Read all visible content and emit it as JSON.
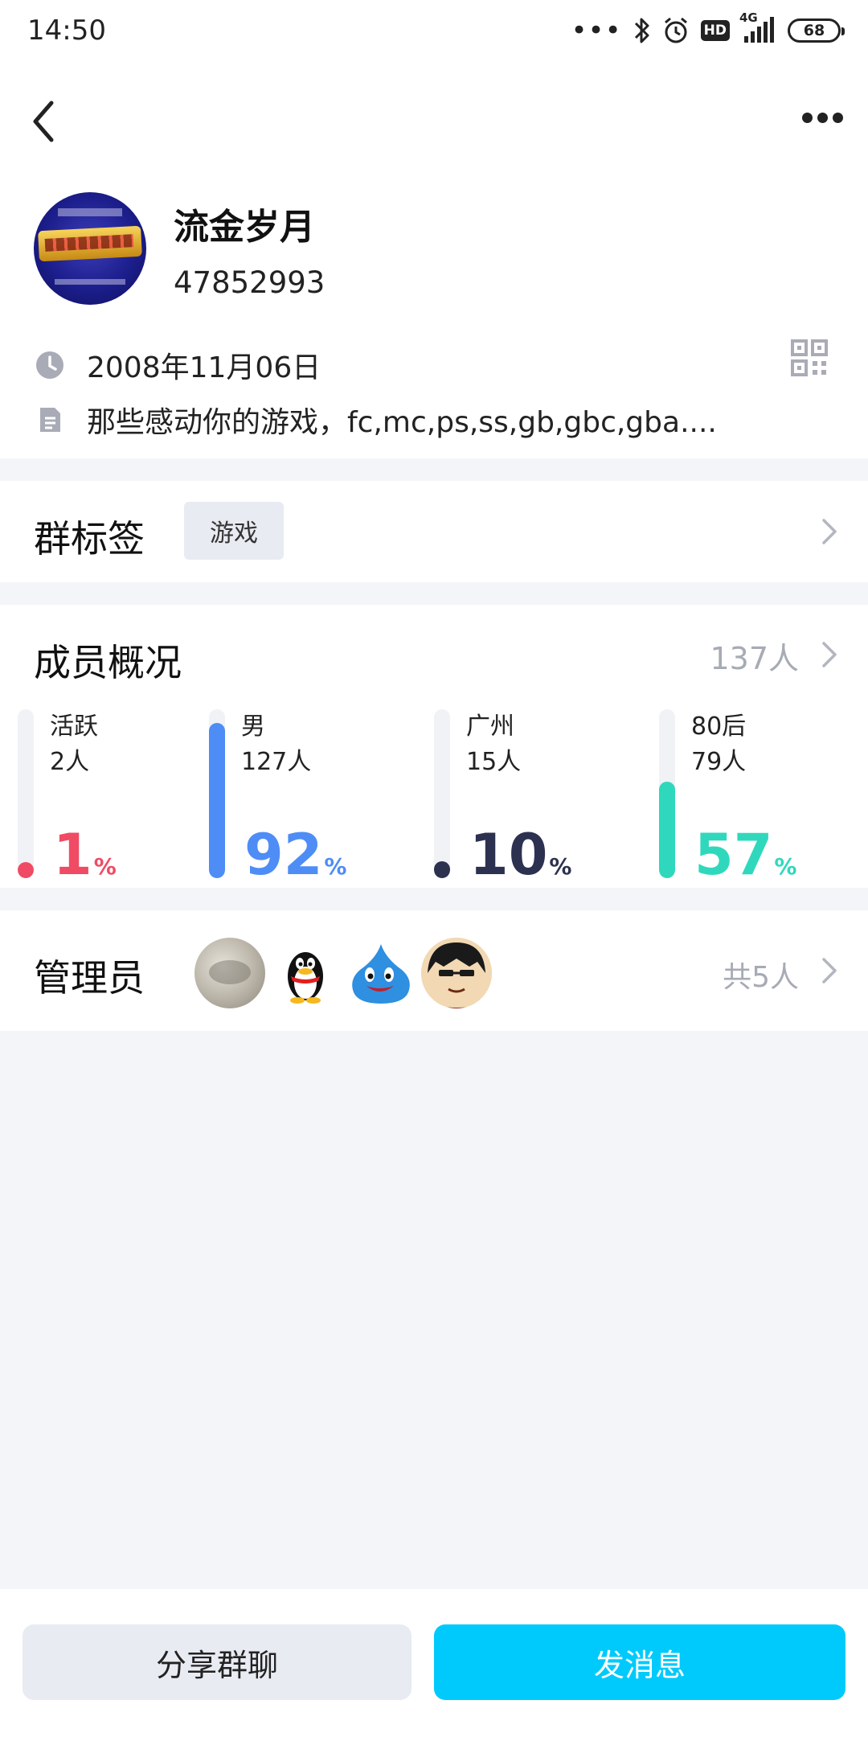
{
  "status_bar": {
    "time": "14:50",
    "network": "4G",
    "hd": "HD",
    "battery": "68"
  },
  "group": {
    "name": "流金岁月",
    "id": "47852993",
    "created_date": "2008年11月06日",
    "description": "那些感动你的游戏，fc,mc,ps,ss,gb,gbc,gba...."
  },
  "tags": {
    "title": "群标签",
    "items": [
      "游戏"
    ]
  },
  "members": {
    "title": "成员概况",
    "count": "137人",
    "stats": [
      {
        "label": "活跃",
        "count": "2人",
        "percent": 1,
        "percent_text": "1",
        "color": "#f04b64"
      },
      {
        "label": "男",
        "count": "127人",
        "percent": 92,
        "percent_text": "92",
        "color": "#4e8df5"
      },
      {
        "label": "广州",
        "count": "15人",
        "percent": 10,
        "percent_text": "10",
        "color": "#2d3150"
      },
      {
        "label": "80后",
        "count": "79人",
        "percent": 57,
        "percent_text": "57",
        "color": "#2fd8bc"
      }
    ],
    "percent_sign": "%"
  },
  "admins": {
    "title": "管理员",
    "total": "共5人"
  },
  "actions": {
    "share_label": "分享群聊",
    "send_label": "发消息"
  }
}
